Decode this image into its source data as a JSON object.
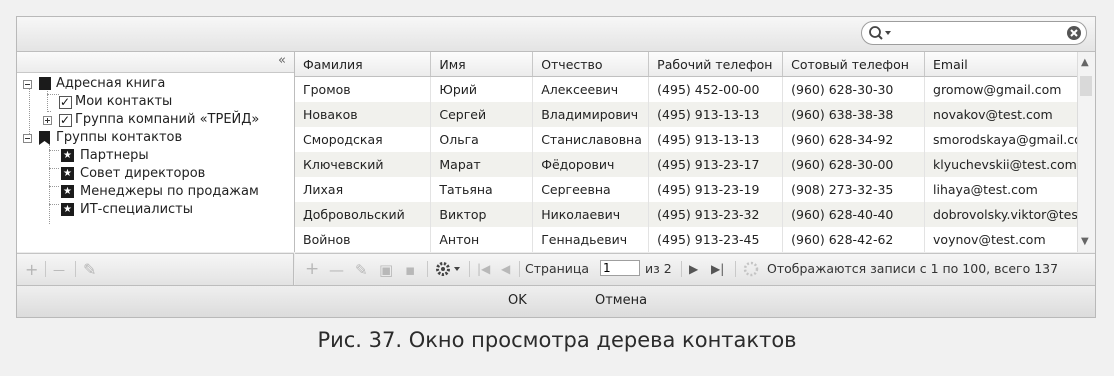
{
  "search": {
    "value": "",
    "placeholder": ""
  },
  "left_panel": {
    "collapse_label": "«"
  },
  "tree": {
    "address_book": "Адресная книга",
    "my_contacts": "Мои контакты",
    "company_group": "Группа компаний «ТРЕЙД»",
    "contact_groups": "Группы контактов",
    "groups": [
      "Партнеры",
      "Совет директоров",
      "Менеджеры по продажам",
      "ИТ-специалисты"
    ]
  },
  "left_toolbar": {
    "add": "+",
    "remove": "—",
    "edit": "✎"
  },
  "grid": {
    "columns": [
      "Фамилия",
      "Имя",
      "Отчество",
      "Рабочий телефон",
      "Сотовый телефон",
      "Email"
    ],
    "rows": [
      [
        "Громов",
        "Юрий",
        "Алексеевич",
        "(495) 452-00-00",
        "(960) 628-30-30",
        "gromow@gmail.com"
      ],
      [
        "Новаков",
        "Сергей",
        "Владимирович",
        "(495) 913-13-13",
        "(960) 638-38-38",
        "novakov@test.com"
      ],
      [
        "Смородская",
        "Ольга",
        "Станиславовна",
        "(495) 913-13-13",
        "(960) 628-34-92",
        "smorodskaya@gmail.com"
      ],
      [
        "Ключевский",
        "Марат",
        "Фёдорович",
        "(495) 913-23-17",
        "(960) 628-30-00",
        "klyuchevskii@test.com"
      ],
      [
        "Лихая",
        "Татьяна",
        "Сергеевна",
        "(495) 913-23-19",
        "(908) 273-32-35",
        "lihaya@test.com"
      ],
      [
        "Добровольский",
        "Виктор",
        "Николаевич",
        "(495) 913-23-32",
        "(960) 628-40-40",
        "dobrovolsky.viktor@test."
      ],
      [
        "Войнов",
        "Антон",
        "Геннадьевич",
        "(495) 913-23-45",
        "(960) 628-42-62",
        "voynov@test.com"
      ]
    ]
  },
  "pager": {
    "page_label": "Страница",
    "page_value": "1",
    "of_label": "из 2",
    "records_text": "Отображаются записи с 1 по 100, всего 137"
  },
  "footer": {
    "ok": "OK",
    "cancel": "Отмена"
  },
  "caption": "Рис. 37. Окно просмотра дерева контактов"
}
